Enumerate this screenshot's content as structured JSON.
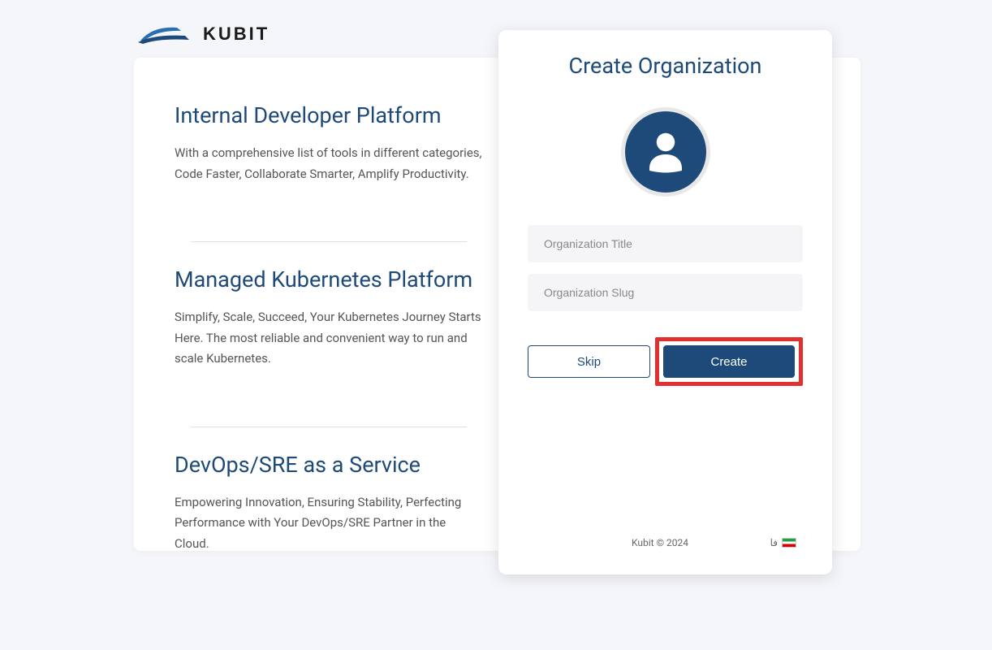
{
  "brand": {
    "name": "KUBIT"
  },
  "features": [
    {
      "title": "Internal Developer Platform",
      "description": "With a comprehensive list of tools in different categories, Code Faster, Collaborate Smarter, Amplify Productivity."
    },
    {
      "title": "Managed Kubernetes Platform",
      "description": "Simplify, Scale, Succeed, Your Kubernetes Journey Starts Here. The most reliable and convenient way to run and scale Kubernetes."
    },
    {
      "title": "DevOps/SRE as a Service",
      "description": "Empowering Innovation, Ensuring Stability, Perfecting Performance with Your DevOps/SRE Partner in the Cloud."
    }
  ],
  "modal": {
    "title": "Create Organization",
    "inputs": {
      "title_placeholder": "Organization Title",
      "slug_placeholder": "Organization Slug"
    },
    "buttons": {
      "skip": "Skip",
      "create": "Create"
    }
  },
  "footer": {
    "copyright": "Kubit © 2024",
    "lang_label": "فا"
  }
}
